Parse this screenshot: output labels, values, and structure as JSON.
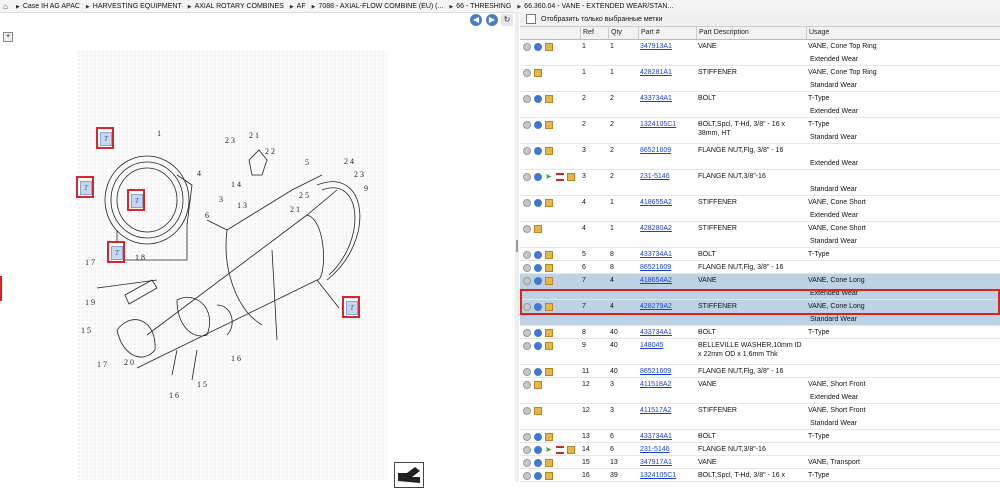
{
  "breadcrumb": [
    "Case IH AG APAC",
    "HARVESTING EQUIPMENT",
    "AXIAL ROTARY COMBINES",
    "AF",
    "7088 - AXIAL-FLOW COMBINE (EU) (...",
    "66 - THRESHING",
    "66.360.04 - VANE - EXTENDED WEAR/STAN..."
  ],
  "filter_label": "Отобразить только выбранные метки",
  "columns": {
    "ref": "Ref",
    "qty": "Qty",
    "part": "Part #",
    "desc": "Part Description",
    "usage": "Usage"
  },
  "diagram_labels": [
    "1",
    "2 3",
    "2 1",
    "2 2",
    "4",
    "5",
    "2 4",
    "2 3",
    "9",
    "1 4",
    "3",
    "1 3",
    "6",
    "2 5",
    "2 1",
    "1 7",
    "1 8",
    "1 9",
    "1 5",
    "1 7",
    "2 0",
    "1 6",
    "1 6",
    "1 5"
  ],
  "callout_letter": "T",
  "rows": [
    {
      "ref": "1",
      "qty": "1",
      "part": "347913A1",
      "desc": "VANE",
      "usage": "VANE, Cone Top Ring",
      "usage2": "Extended Wear",
      "icons": [
        "circle",
        "refresh",
        "box"
      ]
    },
    {
      "ref": "1",
      "qty": "1",
      "part": "428281A1",
      "desc": "STIFFENER",
      "usage": "VANE, Cone Top Ring",
      "usage2": "Standard Wear",
      "icons": [
        "circle",
        "box"
      ]
    },
    {
      "ref": "2",
      "qty": "2",
      "part": "433734A1",
      "desc": "BOLT",
      "usage": "T-Type",
      "usage2": "Extended Wear",
      "icons": [
        "circle",
        "refresh",
        "box"
      ]
    },
    {
      "ref": "2",
      "qty": "2",
      "part": "1324105C1",
      "desc": "BOLT,Spcl, T-Hd, 3/8\" - 16 x 38mm, HT",
      "usage": "T-Type",
      "usage2": "Standard Wear",
      "icons": [
        "circle",
        "refresh",
        "box"
      ]
    },
    {
      "ref": "3",
      "qty": "2",
      "part": "86521609",
      "desc": "FLANGE NUT,Flg, 3/8\" - 16",
      "usage": "",
      "usage2": "Extended Wear",
      "icons": [
        "circle",
        "refresh",
        "box"
      ]
    },
    {
      "ref": "3",
      "qty": "2",
      "part": "231-5146",
      "desc": "FLANGE NUT,3/8\"-16",
      "usage": "",
      "usage2": "Standard Wear",
      "icons": [
        "circle",
        "refresh",
        "arrow",
        "red",
        "box"
      ]
    },
    {
      "ref": "4",
      "qty": "1",
      "part": "418655A2",
      "desc": "STIFFENER",
      "usage": "VANE, Cone Short",
      "usage2": "Extended Wear",
      "icons": [
        "circle",
        "refresh",
        "box"
      ]
    },
    {
      "ref": "4",
      "qty": "1",
      "part": "428280A2",
      "desc": "STIFFENER",
      "usage": "VANE, Cone Short",
      "usage2": "Standard Wear",
      "icons": [
        "circle",
        "box"
      ]
    },
    {
      "ref": "5",
      "qty": "8",
      "part": "433734A1",
      "desc": "BOLT",
      "usage": "T-Type",
      "usage2": "",
      "icons": [
        "circle",
        "refresh",
        "box"
      ]
    },
    {
      "ref": "6",
      "qty": "8",
      "part": "86521609",
      "desc": "FLANGE NUT,Flg, 3/8\" - 16",
      "usage": "",
      "usage2": "",
      "icons": [
        "circle",
        "refresh",
        "box"
      ]
    },
    {
      "ref": "7",
      "qty": "4",
      "part": "418654A2",
      "desc": "VANE",
      "usage": "VANE, Cone Long",
      "usage2": "Extended Wear",
      "icons": [
        "circle",
        "refresh",
        "box"
      ],
      "selected": true
    },
    {
      "ref": "7",
      "qty": "4",
      "part": "428279A2",
      "desc": "STIFFENER",
      "usage": "VANE, Cone Long",
      "usage2": "Standard Wear",
      "icons": [
        "circle",
        "refresh",
        "box"
      ],
      "selected": true
    },
    {
      "ref": "8",
      "qty": "40",
      "part": "433734A1",
      "desc": "BOLT",
      "usage": "T-Type",
      "usage2": "",
      "icons": [
        "circle",
        "refresh",
        "box"
      ]
    },
    {
      "ref": "9",
      "qty": "40",
      "part": "148045",
      "desc": "BELLEVILLE WASHER,10mm ID x 22mm OD x 1.6mm Thk",
      "usage": "",
      "usage2": "",
      "icons": [
        "circle",
        "refresh",
        "box"
      ]
    },
    {
      "ref": "11",
      "qty": "40",
      "part": "86521609",
      "desc": "FLANGE NUT,Flg, 3/8\" - 16",
      "usage": "",
      "usage2": "",
      "icons": [
        "circle",
        "refresh",
        "box"
      ]
    },
    {
      "ref": "12",
      "qty": "3",
      "part": "411518A2",
      "desc": "VANE",
      "usage": "VANE, Short Front",
      "usage2": "Extended Wear",
      "icons": [
        "circle",
        "box"
      ]
    },
    {
      "ref": "12",
      "qty": "3",
      "part": "411517A2",
      "desc": "STIFFENER",
      "usage": "VANE, Short Front",
      "usage2": "Standard Wear",
      "icons": [
        "circle",
        "box"
      ]
    },
    {
      "ref": "13",
      "qty": "6",
      "part": "433734A1",
      "desc": "BOLT",
      "usage": "T-Type",
      "usage2": "",
      "icons": [
        "circle",
        "refresh",
        "box"
      ]
    },
    {
      "ref": "14",
      "qty": "6",
      "part": "231-5146",
      "desc": "FLANGE NUT,3/8\"-16",
      "usage": "",
      "usage2": "",
      "icons": [
        "circle",
        "refresh",
        "arrow",
        "red",
        "box"
      ]
    },
    {
      "ref": "15",
      "qty": "13",
      "part": "347917A1",
      "desc": "VANE",
      "usage": "VANE, Transport",
      "usage2": "",
      "icons": [
        "circle",
        "refresh",
        "box"
      ]
    },
    {
      "ref": "16",
      "qty": "39",
      "part": "1324105C1",
      "desc": "BOLT,Spcl, T-Hd, 3/8\" - 16 x 38mm, HT",
      "usage": "T-Type",
      "usage2": "",
      "icons": [
        "circle",
        "refresh",
        "box"
      ]
    }
  ]
}
